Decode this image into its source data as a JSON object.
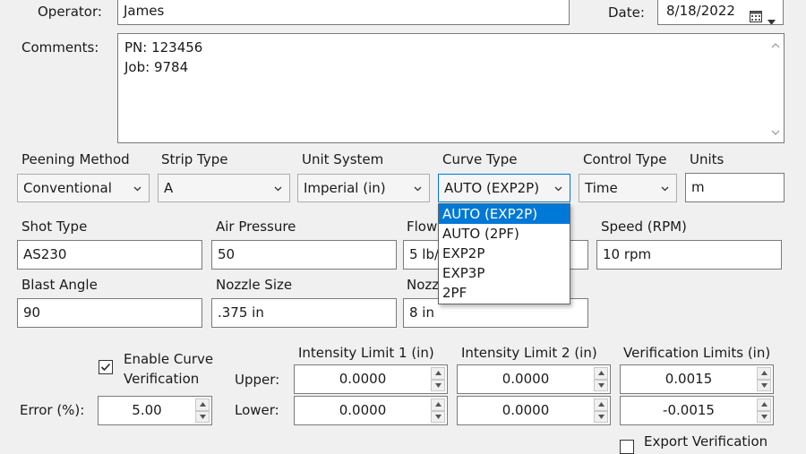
{
  "operator": {
    "label": "Operator:",
    "value": "James"
  },
  "date": {
    "label": "Date:",
    "value": "8/18/2022"
  },
  "comments": {
    "label": "Comments:",
    "lines": [
      "PN: 123456",
      "Job: 9784"
    ]
  },
  "row1": {
    "peening_method": {
      "label": "Peening Method",
      "value": "Conventional"
    },
    "strip_type": {
      "label": "Strip Type",
      "value": "A"
    },
    "unit_system": {
      "label": "Unit System",
      "value": "Imperial (in)"
    },
    "curve_type": {
      "label": "Curve Type",
      "value": "AUTO (EXP2P)"
    },
    "control_type": {
      "label": "Control Type",
      "value": "Time"
    },
    "units": {
      "label": "Units",
      "value": "m"
    }
  },
  "curve_type_options": [
    "AUTO (EXP2P)",
    "AUTO (2PF)",
    "EXP2P",
    "EXP3P",
    "2PF"
  ],
  "row2": {
    "shot_type": {
      "label": "Shot Type",
      "value": "AS230"
    },
    "air_pressure": {
      "label": "Air Pressure",
      "value": "50"
    },
    "flow": {
      "label": "Flow",
      "value": "5 lb/"
    },
    "speed": {
      "label": "Speed (RPM)",
      "value": "10 rpm"
    }
  },
  "row3": {
    "blast_angle": {
      "label": "Blast Angle",
      "value": "90"
    },
    "nozzle_size": {
      "label": "Nozzle Size",
      "value": ".375 in"
    },
    "nozzle_other": {
      "label": "Nozz",
      "value": "8 in"
    }
  },
  "verification": {
    "enable_line1": "Enable Curve",
    "enable_line2": "Verification",
    "enabled": true,
    "error_label": "Error (%):",
    "error_value": "5.00",
    "upper_label": "Upper:",
    "lower_label": "Lower:",
    "col1_header": "Intensity Limit 1 (in)",
    "col2_header": "Intensity Limit 2 (in)",
    "col3_header": "Verification Limits (in)",
    "limit1_upper": "0.0000",
    "limit1_lower": "0.0000",
    "limit2_upper": "0.0000",
    "limit2_lower": "0.0000",
    "ver_upper": "0.0015",
    "ver_lower": "-0.0015",
    "export_label": "Export Verification"
  },
  "colors": {
    "accent": "#0078d7",
    "border": "#7a7a7a",
    "background": "#f0f0f0"
  }
}
